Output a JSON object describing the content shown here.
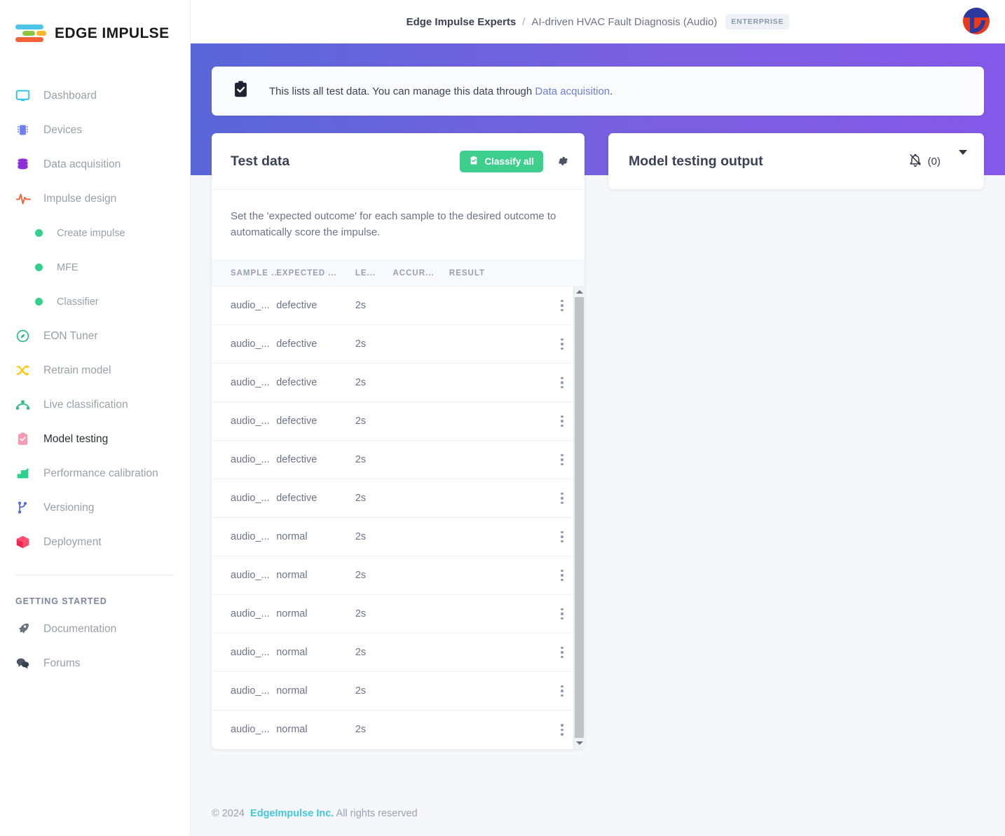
{
  "brand": {
    "name": "EDGE IMPULSE",
    "accent_green": "#3ecf8e",
    "accent_purple": "#5a67d8"
  },
  "sidebar": {
    "items": [
      {
        "label": "Dashboard",
        "icon": "monitor-icon"
      },
      {
        "label": "Devices",
        "icon": "chip-icon"
      },
      {
        "label": "Data acquisition",
        "icon": "database-icon"
      },
      {
        "label": "Impulse design",
        "icon": "pulse-icon"
      }
    ],
    "sub_items": [
      {
        "label": "Create impulse",
        "icon": "green-dot-icon"
      },
      {
        "label": "MFE",
        "icon": "green-dot-icon"
      },
      {
        "label": "Classifier",
        "icon": "green-dot-icon"
      }
    ],
    "items2": [
      {
        "label": "EON Tuner",
        "icon": "compass-icon"
      },
      {
        "label": "Retrain model",
        "icon": "shuffle-icon"
      },
      {
        "label": "Live classification",
        "icon": "bezier-icon"
      },
      {
        "label": "Model testing",
        "icon": "clipboard-check-icon",
        "active": true
      },
      {
        "label": "Performance calibration",
        "icon": "bar-chart-icon"
      },
      {
        "label": "Versioning",
        "icon": "git-branch-icon"
      },
      {
        "label": "Deployment",
        "icon": "box-icon"
      }
    ],
    "section_label": "GETTING STARTED",
    "items3": [
      {
        "label": "Documentation",
        "icon": "rocket-icon"
      },
      {
        "label": "Forums",
        "icon": "chat-icon"
      }
    ]
  },
  "header": {
    "org": "Edge Impulse Experts",
    "separator": "/",
    "project": "AI-driven HVAC Fault Diagnosis (Audio)",
    "badge": "ENTERPRISE",
    "avatar_label": "user-avatar"
  },
  "banner": {
    "icon": "clipboard-check-icon",
    "text_before": "This lists all test data. You can manage this data through ",
    "link": "Data acquisition",
    "text_after": "."
  },
  "test_data": {
    "title": "Test data",
    "classify_button": "Classify all",
    "classify_icon": "clipboard-check-icon",
    "gear_icon": "gear-icon",
    "subtitle": "Set the 'expected outcome' for each sample to the desired outcome to automatically score the impulse.",
    "columns": [
      "SAMPLE ...",
      "EXPECTED ...",
      "LE...",
      "ACCUR...",
      "RESULT",
      ""
    ],
    "rows": [
      {
        "sample": "audio_...",
        "expected": "defective",
        "length": "2s",
        "accuracy": "",
        "result": ""
      },
      {
        "sample": "audio_...",
        "expected": "defective",
        "length": "2s",
        "accuracy": "",
        "result": ""
      },
      {
        "sample": "audio_...",
        "expected": "defective",
        "length": "2s",
        "accuracy": "",
        "result": ""
      },
      {
        "sample": "audio_...",
        "expected": "defective",
        "length": "2s",
        "accuracy": "",
        "result": ""
      },
      {
        "sample": "audio_...",
        "expected": "defective",
        "length": "2s",
        "accuracy": "",
        "result": ""
      },
      {
        "sample": "audio_...",
        "expected": "defective",
        "length": "2s",
        "accuracy": "",
        "result": ""
      },
      {
        "sample": "audio_...",
        "expected": "normal",
        "length": "2s",
        "accuracy": "",
        "result": ""
      },
      {
        "sample": "audio_...",
        "expected": "normal",
        "length": "2s",
        "accuracy": "",
        "result": ""
      },
      {
        "sample": "audio_...",
        "expected": "normal",
        "length": "2s",
        "accuracy": "",
        "result": ""
      },
      {
        "sample": "audio_...",
        "expected": "normal",
        "length": "2s",
        "accuracy": "",
        "result": ""
      },
      {
        "sample": "audio_...",
        "expected": "normal",
        "length": "2s",
        "accuracy": "",
        "result": ""
      },
      {
        "sample": "audio_...",
        "expected": "normal",
        "length": "2s",
        "accuracy": "",
        "result": ""
      }
    ]
  },
  "model_output": {
    "title": "Model testing output",
    "mute_icon": "bell-slash-icon",
    "count": "(0)",
    "caret_icon": "chevron-down-icon"
  },
  "footer": {
    "copyright": "© 2024",
    "company": "EdgeImpulse Inc.",
    "rights": "All rights reserved"
  }
}
